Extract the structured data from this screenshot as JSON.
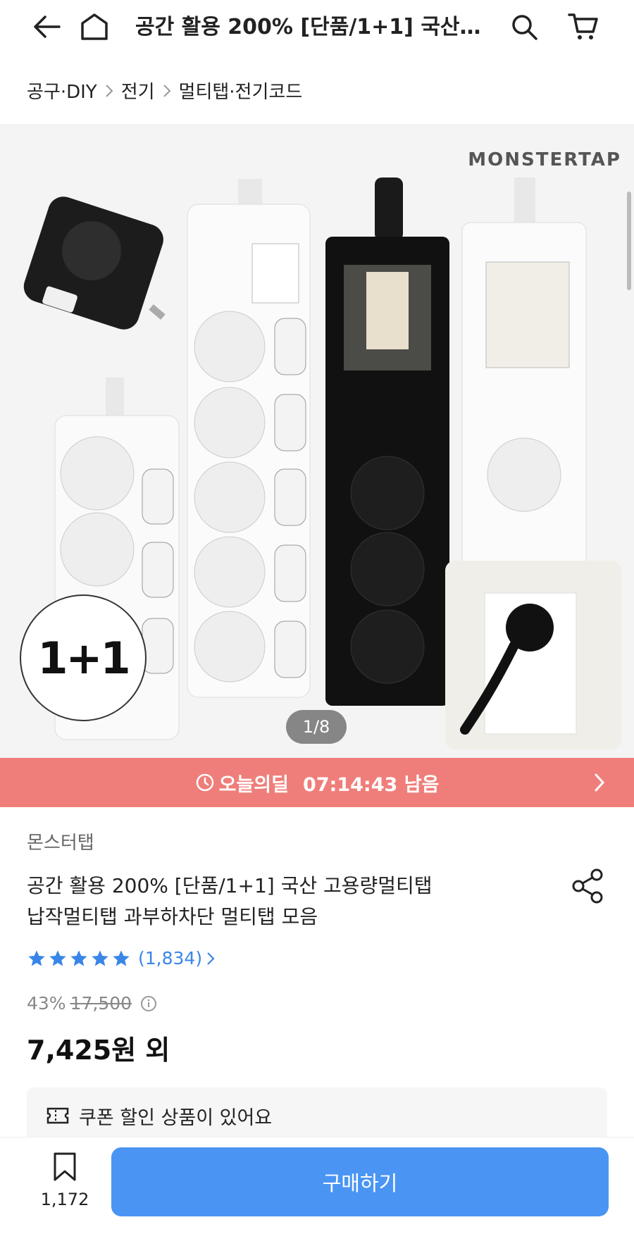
{
  "header": {
    "title": "공간 활용 200% [단품/1+1] 국산…"
  },
  "breadcrumb": [
    "공구·DIY",
    "전기",
    "멀티탭·전기코드"
  ],
  "hero": {
    "watermark": "MONSTERTAP",
    "badge": "1+1",
    "counter": "1/8"
  },
  "deal": {
    "label": "오늘의딜",
    "timer": "07:14:43 남음"
  },
  "product": {
    "seller": "몬스터탭",
    "title_line1": "공간 활용 200% [단품/1+1] 국산 고용량멀티탭",
    "title_line2": "납작멀티탭 과부하차단 멀티탭 모음",
    "rating": 5,
    "review_count": "(1,834)",
    "discount": "43%",
    "original_price": "17,500",
    "price": "7,425원 외"
  },
  "coupon": {
    "text": "쿠폰 할인 상품이 있어요"
  },
  "bottom": {
    "wish_count": "1,172",
    "buy_label": "구매하기"
  },
  "colors": {
    "deal_bg": "#ef7e7a",
    "buy_bg": "#4a95f3",
    "star": "#3a86e8"
  }
}
